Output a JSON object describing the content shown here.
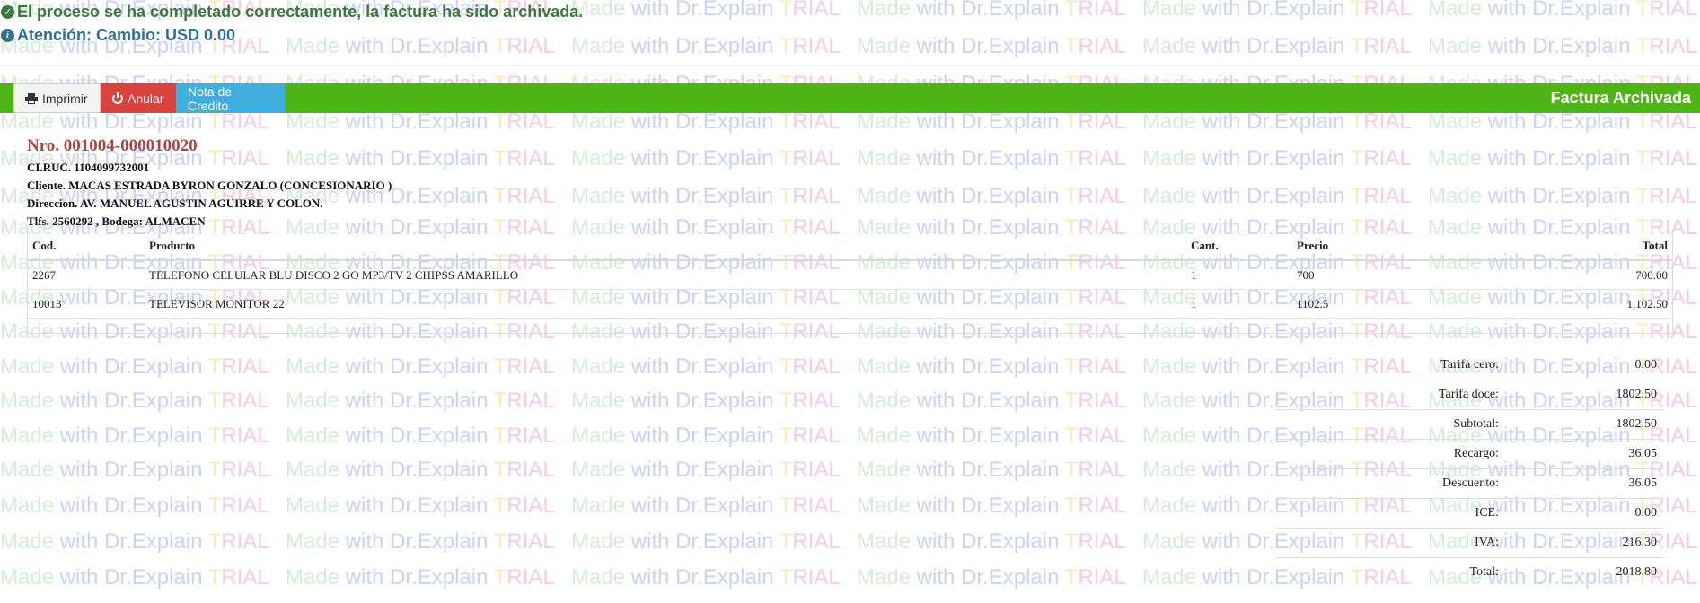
{
  "alerts": {
    "success": "El proceso se ha completado correctamente, la factura ha sido archivada.",
    "info": "Atención: Cambio: USD 0.00",
    "success_icon": "check-circle-icon",
    "info_icon": "info-circle-icon"
  },
  "toolbar": {
    "print_label": "Imprimir",
    "void_label": "Anular",
    "credit_note_label": "Nota de Credito",
    "title": "Factura Archivada",
    "print_icon": "printer-icon",
    "void_icon": "power-icon",
    "bar_color": "#4fb517"
  },
  "invoice": {
    "number": "Nro. 001004-000010020",
    "ruc": "CI.RUC. 1104099732001",
    "client": "Cliente. MACAS ESTRADA BYRON GONZALO (CONCESIONARIO )",
    "address": "Direccion. AV. MANUEL AGUSTIN AGUIRRE Y COLON.",
    "phone_store": "Tlfs. 2560292 , Bodega: ALMACEN"
  },
  "items": {
    "headers": [
      "Cod.",
      "Producto",
      "Cant.",
      "Precio",
      "Total"
    ],
    "rows": [
      [
        "2267",
        "TELEFONO CELULAR BLU DISCO 2 GO MP3/TV 2 CHIPSS AMARILLO",
        "1",
        "700",
        "700.00"
      ],
      [
        "10013",
        "TELEVISOR MONITOR 22",
        "1",
        "1102.5",
        "1,102.50"
      ]
    ]
  },
  "totals": [
    {
      "label": "Tarifa cero:",
      "value": "0.00"
    },
    {
      "label": "Tarifa doce:",
      "value": "1802.50"
    },
    {
      "label": "Subtotal:",
      "value": "1802.50"
    },
    {
      "label": "Recargo:",
      "value": "36.05"
    },
    {
      "label": "Descuento:",
      "value": "36.05"
    },
    {
      "label": "ICE:",
      "value": "0.00"
    },
    {
      "label": "IVA:",
      "value": "216.30"
    },
    {
      "label": "Total:",
      "value": "2018.80"
    }
  ],
  "watermark": {
    "made": "Made",
    "with": "with",
    "brand": "Dr.Explain",
    "trial_t": "T",
    "trial_rest": "RIAL"
  }
}
